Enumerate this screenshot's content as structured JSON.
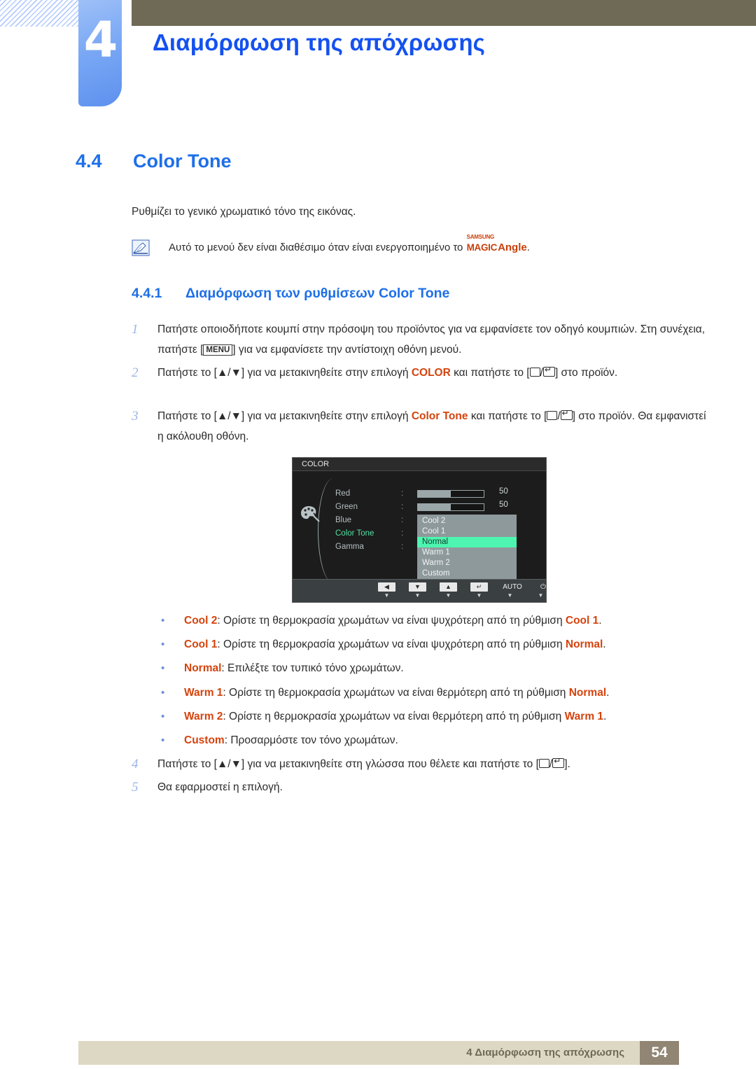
{
  "header": {
    "chapter_number": "4",
    "chapter_title": "Διαμόρφωση της απόχρωσης"
  },
  "section": {
    "number": "4.4",
    "title": "Color Tone",
    "intro": "Ρυθμίζει το γενικό χρωματικό τόνο της εικόνας."
  },
  "note": {
    "icon": "note-pencil-icon",
    "text_before": "Αυτό το μενού δεν είναι διαθέσιμο όταν είναι ενεργοποιημένο το",
    "logo_samsung": "SAMSUNG",
    "logo_magic": "MAGIC",
    "logo_angle": "Angle",
    "text_after": "."
  },
  "subsection": {
    "number": "4.4.1",
    "title": "Διαμόρφωση των ρυθμίσεων Color Tone"
  },
  "steps": [
    {
      "n": "1",
      "part1": "Πατήστε οποιοδήποτε κουμπί στην πρόσοψη του προϊόντος για να εμφανίσετε τον οδηγό κουμπιών. Στη συνέχεια, πατήστε [",
      "key": "MENU",
      "part2": "] για να εμφανίσετε την αντίστοιχη οθόνη μενού."
    },
    {
      "n": "2",
      "part1": "Πατήστε το [▲/▼] για να μετακινηθείτε στην επιλογή",
      "keyword": "COLOR",
      "part2": "και πατήστε το [",
      "part3": "] στο προϊόν."
    },
    {
      "n": "3",
      "part1": "Πατήστε το [▲/▼] για να μετακινηθείτε στην επιλογή",
      "keyword": "Color Tone",
      "part2": "και πατήστε το [",
      "part3": "] στο προϊόν. Θα εμφανιστεί η ακόλουθη οθόνη."
    },
    {
      "n": "4",
      "part1": "Πατήστε το [▲/▼] για να μετακινηθείτε στη γλώσσα που θέλετε και πατήστε το [",
      "part2": "]."
    },
    {
      "n": "5",
      "part1": "Θα εφαρμοστεί η επιλογή."
    }
  ],
  "osd": {
    "title": "COLOR",
    "icon": "color-palette-icon",
    "rows": [
      {
        "label": "Red",
        "colon": ":",
        "value": "50",
        "fill_percent": 50
      },
      {
        "label": "Green",
        "colon": ":",
        "value": "50",
        "fill_percent": 50
      },
      {
        "label": "Blue",
        "colon": ":"
      },
      {
        "label": "Color Tone",
        "colon": ":"
      },
      {
        "label": "Gamma",
        "colon": ":"
      }
    ],
    "dropdown_options": [
      "Cool 2",
      "Cool 1",
      "Normal",
      "Warm 1",
      "Warm 2",
      "Custom"
    ],
    "dropdown_selected": "Normal",
    "highlight_color": "#4df5b0",
    "active_label_color": "#55e0a4",
    "buttons": [
      {
        "name": "left-arrow-button",
        "glyph": "◀"
      },
      {
        "name": "down-arrow-button",
        "glyph": "▼"
      },
      {
        "name": "up-arrow-button",
        "glyph": "▲"
      },
      {
        "name": "enter-button",
        "glyph": "↵"
      },
      {
        "name": "auto-button",
        "glyph": "AUTO"
      },
      {
        "name": "power-button",
        "glyph": "⏻"
      }
    ]
  },
  "bullets": [
    {
      "term": "Cool 2",
      "text": ": Ορίστε τη θερμοκρασία χρωμάτων να είναι ψυχρότερη από τη ρύθμιση ",
      "term2": "Cool 1",
      "tail": "."
    },
    {
      "term": "Cool 1",
      "text": ": Ορίστε τη θερμοκρασία χρωμάτων να είναι ψυχρότερη από τη ρύθμιση ",
      "term2": "Normal",
      "tail": "."
    },
    {
      "term": "Normal",
      "text": ": Επιλέξτε τον τυπικό τόνο χρωμάτων.",
      "term2": "",
      "tail": ""
    },
    {
      "term": "Warm 1",
      "text": ": Ορίστε τη θερμοκρασία χρωμάτων να είναι θερμότερη από τη ρύθμιση ",
      "term2": "Normal",
      "tail": "."
    },
    {
      "term": "Warm 2",
      "text": ": Ορίστε η θερμοκρασία χρωμάτων να είναι θερμότερη από τη ρύθμιση ",
      "term2": "Warm 1",
      "tail": "."
    },
    {
      "term": "Custom",
      "text": ": Προσαρμόστε τον τόνο χρωμάτων.",
      "term2": "",
      "tail": ""
    }
  ],
  "footer": {
    "text": "4 Διαμόρφωση της απόχρωσης",
    "page": "54"
  },
  "colors": {
    "accent_blue": "#1451f0",
    "heading_blue": "#1e6fe8",
    "keyword_orange": "#d4430d",
    "header_bar": "#6e6a55",
    "footer_bar": "#ddd8c4",
    "footer_page_box": "#918573"
  }
}
